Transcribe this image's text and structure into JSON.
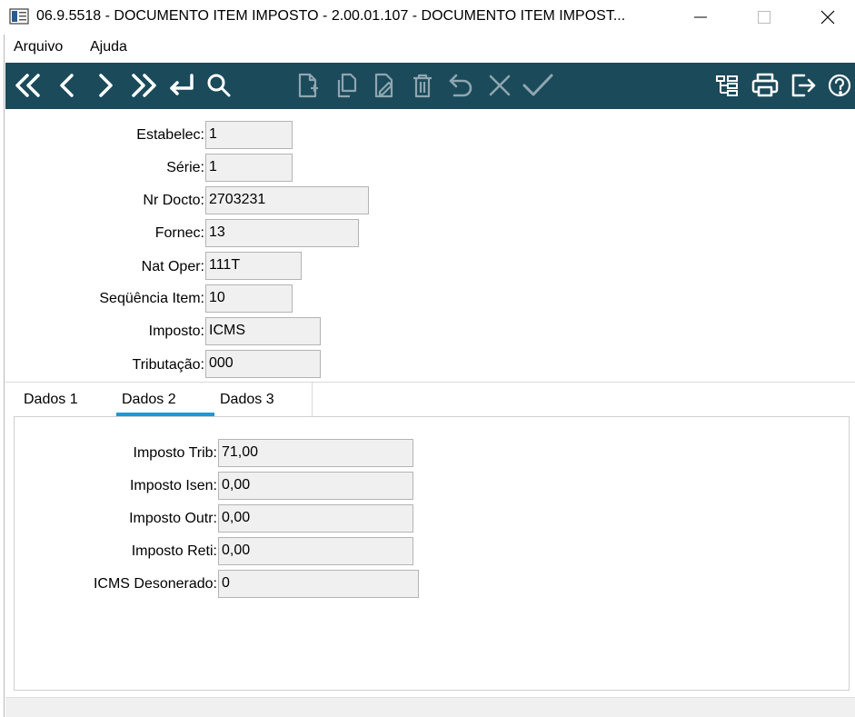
{
  "window": {
    "title": "06.9.5518 - DOCUMENTO ITEM IMPOSTO - 2.00.01.107 - DOCUMENTO ITEM IMPOST...",
    "controls": [
      "minimize-icon",
      "maximize-icon",
      "close-icon"
    ]
  },
  "menu": {
    "items": [
      "Arquivo",
      "Ajuda"
    ]
  },
  "toolbar": {
    "accent_color": "#1b4a5a",
    "nav_buttons": [
      "first-icon",
      "previous-icon",
      "next-icon",
      "last-icon",
      "goto-icon",
      "search-icon"
    ],
    "edit_buttons": [
      "new-icon",
      "copy-icon",
      "edit-icon",
      "delete-icon",
      "undo-icon",
      "cancel-icon",
      "confirm-icon"
    ],
    "right_buttons": [
      "hierarchy-icon",
      "print-icon",
      "exit-icon",
      "help-icon"
    ]
  },
  "header_fields": [
    {
      "label": "Estabelec:",
      "value": "1"
    },
    {
      "label": "Série:",
      "value": "1"
    },
    {
      "label": "Nr Docto:",
      "value": "2703231"
    },
    {
      "label": "Fornec:",
      "value": "13"
    },
    {
      "label": "Nat Oper:",
      "value": "111T"
    },
    {
      "label": "Seqüência Item:",
      "value": "10"
    },
    {
      "label": "Imposto:",
      "value": "ICMS"
    },
    {
      "label": "Tributação:",
      "value": "000"
    }
  ],
  "tabs": {
    "items": [
      "Dados 1",
      "Dados 2",
      "Dados 3"
    ],
    "active": "Dados 2",
    "active_color": "#1a9ad8"
  },
  "tab_fields": [
    {
      "label": "Imposto Trib:",
      "value": "71,00"
    },
    {
      "label": "Imposto Isen:",
      "value": "0,00"
    },
    {
      "label": "Imposto Outr:",
      "value": "0,00"
    },
    {
      "label": "Imposto Reti:",
      "value": "0,00"
    },
    {
      "label": "ICMS Desonerado:",
      "value": "0"
    }
  ]
}
